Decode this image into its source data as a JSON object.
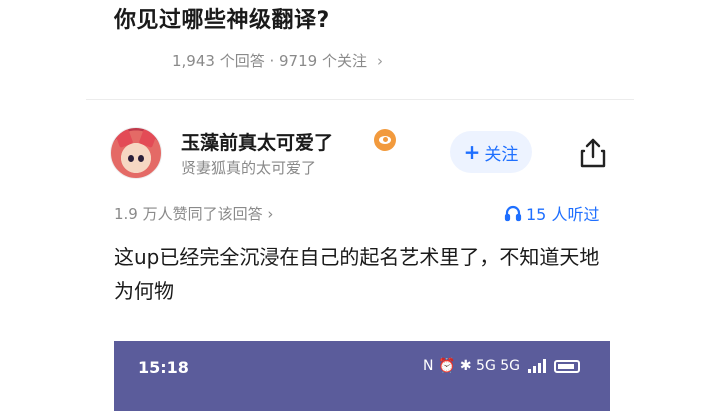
{
  "question": {
    "title": "你见过哪些神级翻译?",
    "meta": "1,943 个回答 · 9719 个关注",
    "chevron": "›"
  },
  "author": {
    "name": "玉藻前真太可爱了",
    "subtitle": "贤妻狐真的太可爱了",
    "avatar_icon": "avatar-anime-fox-girl",
    "badge_icon": "eye-badge-icon",
    "follow_label": "关注",
    "share_icon": "share-icon"
  },
  "stats": {
    "agree": "1.9 万人赞同了该回答",
    "agree_chevron": "›",
    "listen": "15 人听过"
  },
  "answer": {
    "text": "这up已经完全沉浸在自己的起名艺术里了，不知道天地为何物"
  },
  "embedded_screenshot": {
    "time": "15:18",
    "status": "N ⏰ ✱ 5G 5G",
    "background": "#5b5c9b"
  },
  "colors": {
    "accent": "#1e6fff",
    "follow_bg": "#edf3ff",
    "muted": "#8a8a8a"
  }
}
